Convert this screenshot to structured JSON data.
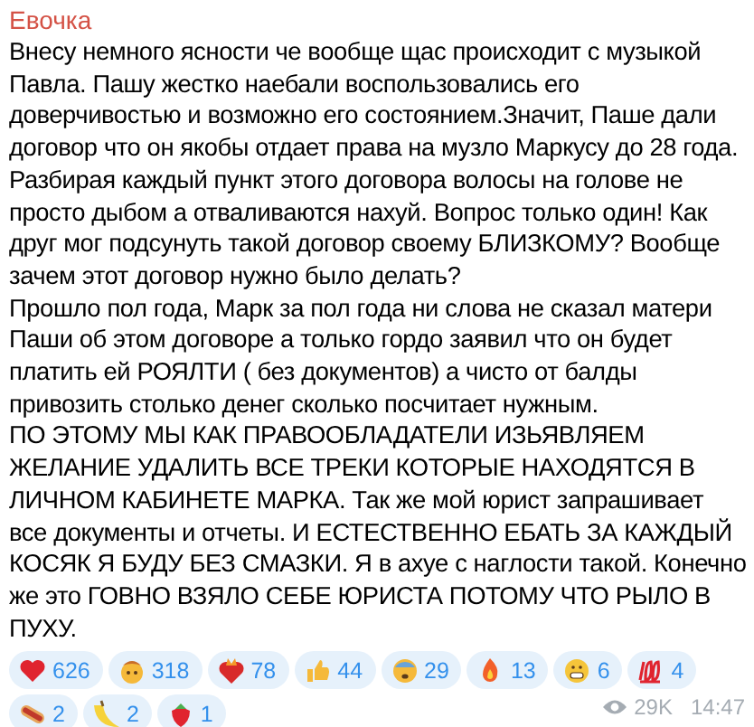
{
  "author": "Евочка",
  "paragraphs": [
    "Внесу немного ясности че вообще щас происходит с музыкой Павла. Пашу жестко наебали воспользовались его доверчивостью и возможно его состоянием.Значит, Паше дали договор что он якобы отдает права на музло Маркусу до 28 года. Разбирая каждый пункт этого договора волосы на голове не просто дыбом а отваливаются нахуй. Вопрос только один! Как друг мог подсунуть такой договор своему БЛИЗКОМУ? Вообще зачем этот договор нужно было делать?",
    "Прошло пол года, Марк за пол года ни слова не сказал матери Паши об этом договоре а только гордо заявил что он будет платить ей РОЯЛТИ ( без документов) а чисто от балды привозить столько денег сколько посчитает нужным.",
    "ПО ЭТОМУ МЫ КАК ПРАВООБЛАДАТЕЛИ ИЗЬЯВЛЯЕМ ЖЕЛАНИЕ УДАЛИТЬ ВСЕ ТРЕКИ КОТОРЫЕ НАХОДЯТСЯ В ЛИЧНОМ КАБИНЕТЕ МАРКА. Так же мой юрист запрашивает все документы и отчеты. И ЕСТЕСТВЕННО ЕБАТЬ ЗА КАЖДЫЙ КОСЯК Я БУДУ БЕЗ СМАЗКИ. Я в ахуе с наглости такой. Конечно же это ГОВНО ВЗЯЛО СЕБЕ ЮРИСТА ПОТОМУ ЧТО РЫЛО В ПУХУ."
  ],
  "reactions": [
    {
      "kind": "heart",
      "count": "626"
    },
    {
      "kind": "mindblown",
      "count": "318"
    },
    {
      "kind": "fireheart",
      "count": "78"
    },
    {
      "kind": "thumbsup",
      "count": "44"
    },
    {
      "kind": "scared",
      "count": "29"
    },
    {
      "kind": "fire",
      "count": "13"
    },
    {
      "kind": "grin",
      "count": "6"
    },
    {
      "kind": "hundred",
      "count": "4"
    },
    {
      "kind": "hotdog",
      "count": "2"
    },
    {
      "kind": "banana",
      "count": "2"
    },
    {
      "kind": "strawberry",
      "count": "1"
    }
  ],
  "views": "29K",
  "time": "14:47"
}
